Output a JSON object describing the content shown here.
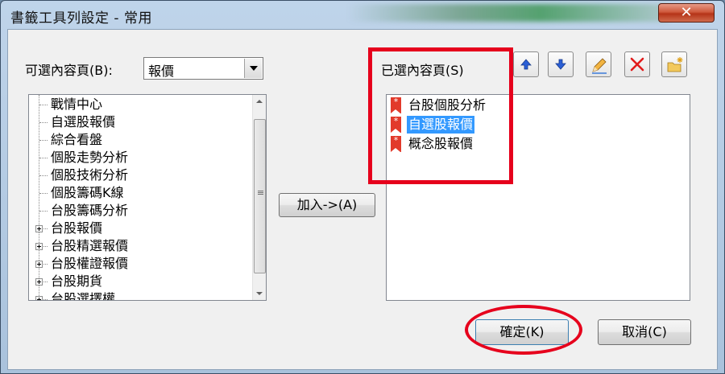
{
  "window": {
    "title": "書籤工具列設定 - 常用",
    "close_glyph": "✕"
  },
  "left": {
    "label": "可選內容頁(B):",
    "combo_value": "報價",
    "tree_items": [
      {
        "label": "戰情中心",
        "expandable": false
      },
      {
        "label": "自選股報價",
        "expandable": false
      },
      {
        "label": "綜合看盤",
        "expandable": false
      },
      {
        "label": "個股走勢分析",
        "expandable": false
      },
      {
        "label": "個股技術分析",
        "expandable": false
      },
      {
        "label": "個股籌碼K線",
        "expandable": false
      },
      {
        "label": "台股籌碼分析",
        "expandable": false
      },
      {
        "label": "台股報價",
        "expandable": true
      },
      {
        "label": "台股精選報價",
        "expandable": true
      },
      {
        "label": "台股權證報價",
        "expandable": true
      },
      {
        "label": "台股期貨",
        "expandable": true
      },
      {
        "label": "台股選擇權",
        "expandable": true
      }
    ]
  },
  "add_button": "加入->(A)",
  "right": {
    "label": "已選內容頁(S)",
    "items": [
      "台股個股分析",
      "自選股報價",
      "概念股報價"
    ],
    "selected_index": 1,
    "toolbar": {
      "move_up": "arrow-up-icon",
      "move_down": "arrow-down-icon",
      "rename": "pencil-icon",
      "delete": "delete-x-icon",
      "new_folder": "new-folder-icon"
    }
  },
  "buttons": {
    "ok": "確定(K)",
    "cancel": "取消(C)"
  },
  "colors": {
    "highlight": "#3399ff",
    "annotation_red": "#e6001c"
  }
}
